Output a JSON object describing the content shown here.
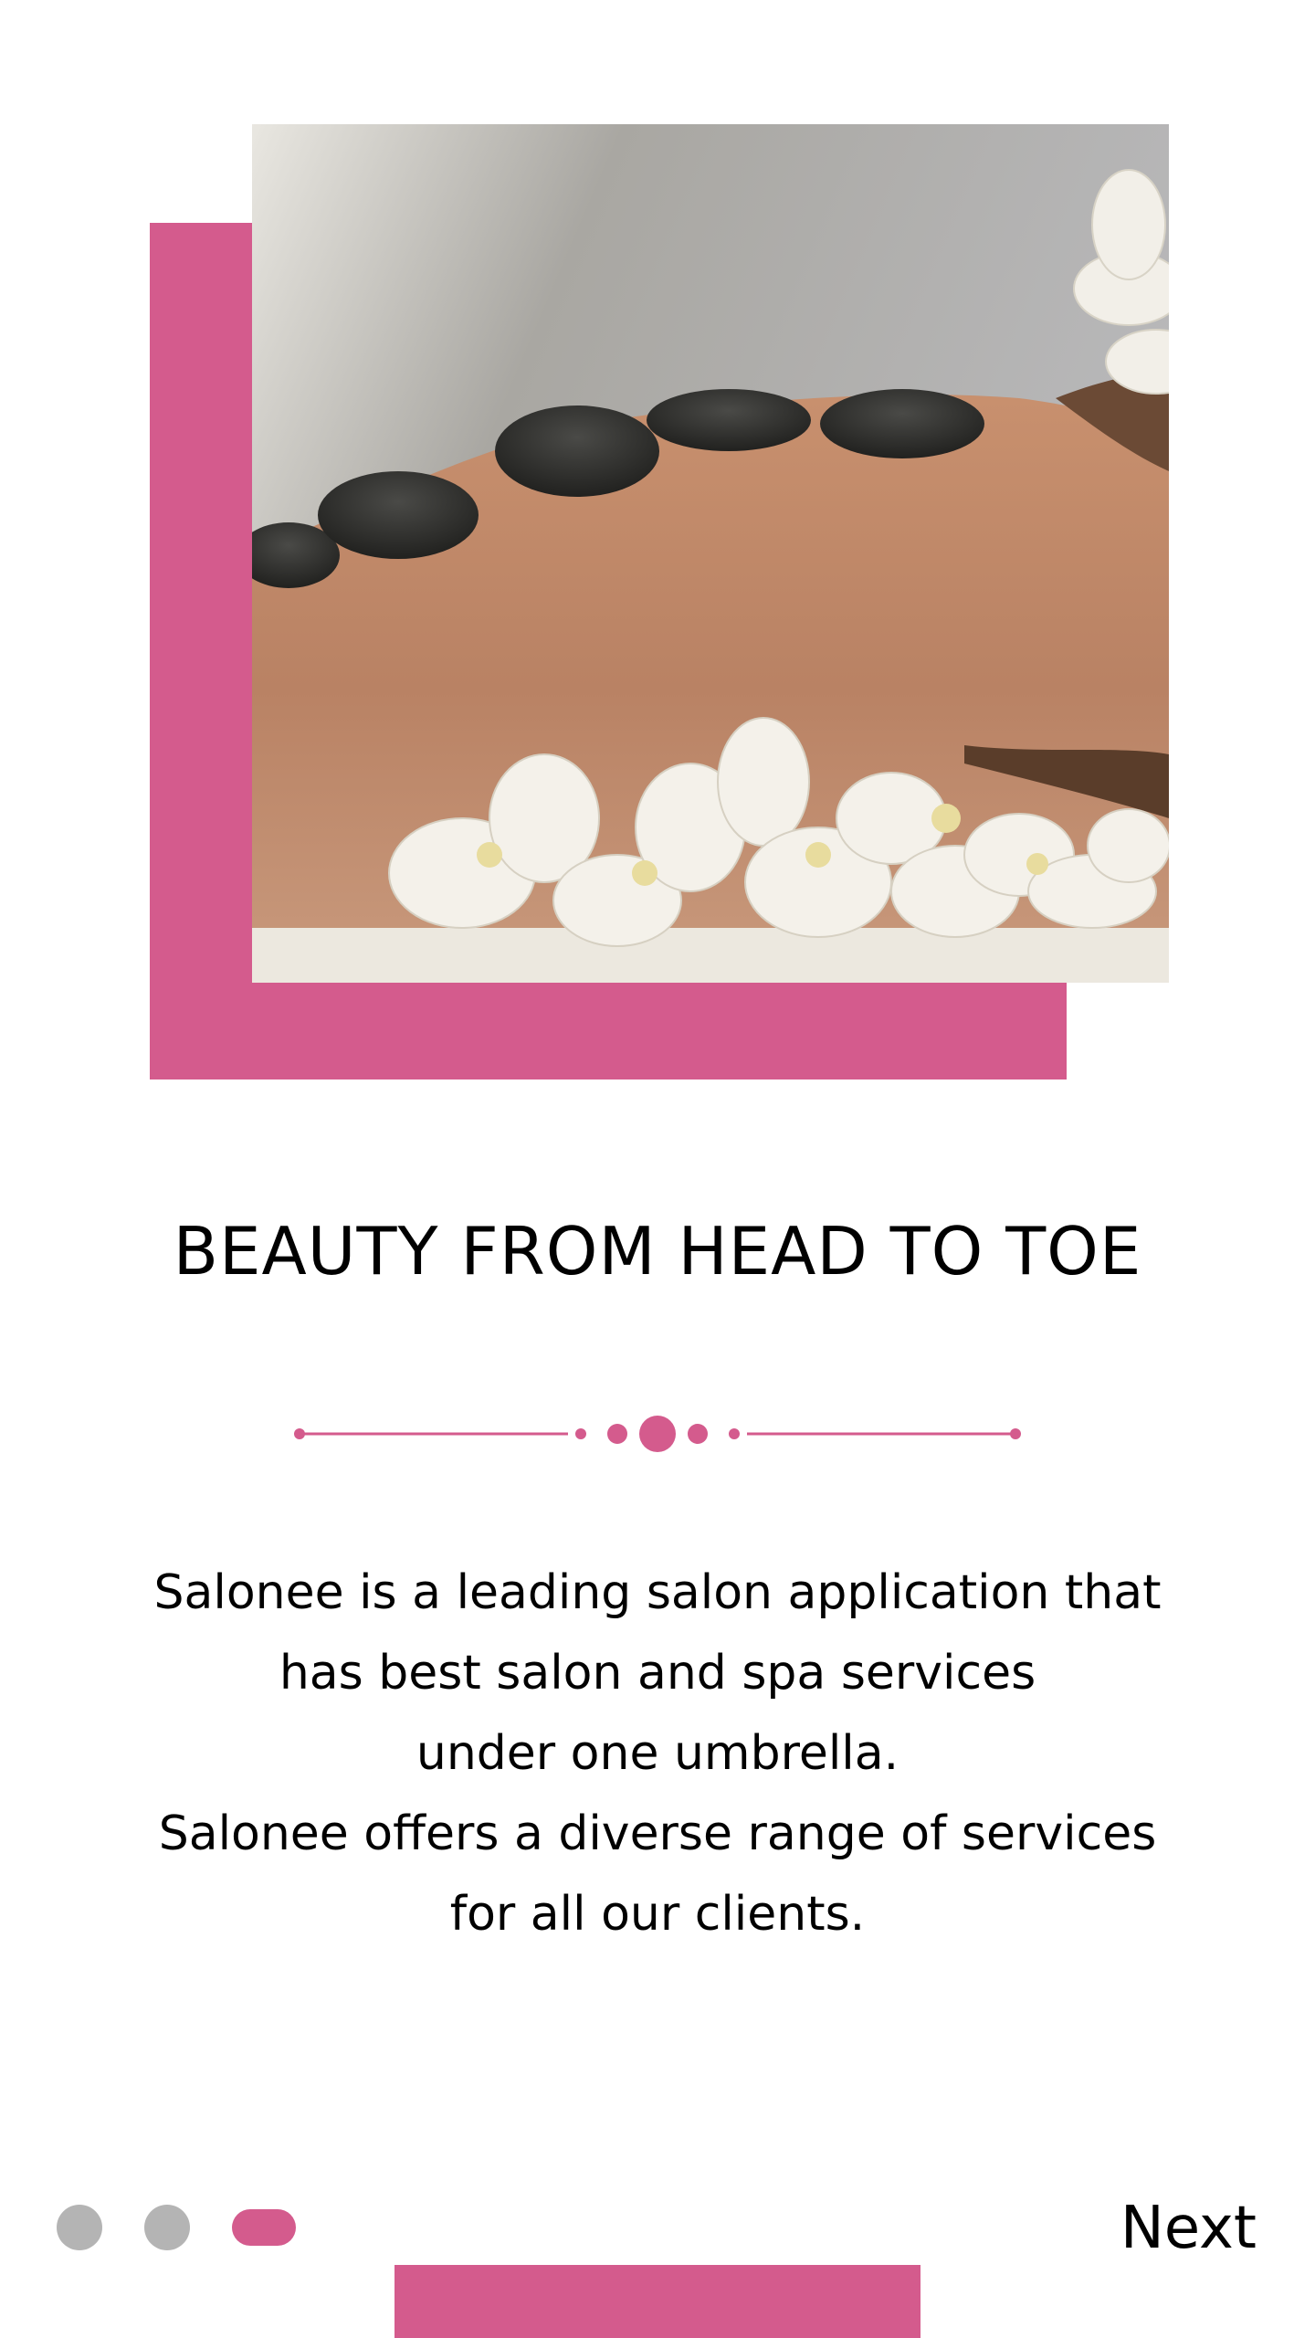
{
  "colors": {
    "accent": "#d45b8d",
    "inactive_dot": "#b4b4b4",
    "text": "#000000",
    "background": "#ffffff"
  },
  "hero": {
    "image_alt": "hot stone massage with orchids",
    "icon": "spa-photo"
  },
  "headline": "BEAUTY FROM HEAD TO TOE",
  "description": {
    "lines": [
      "Salonee is a leading salon application that",
      "has best salon and spa services",
      "under one umbrella.",
      "Salonee offers a diverse range of services",
      "for all our clients."
    ]
  },
  "pager": {
    "total": 3,
    "active_index": 2
  },
  "next_label": "Next"
}
